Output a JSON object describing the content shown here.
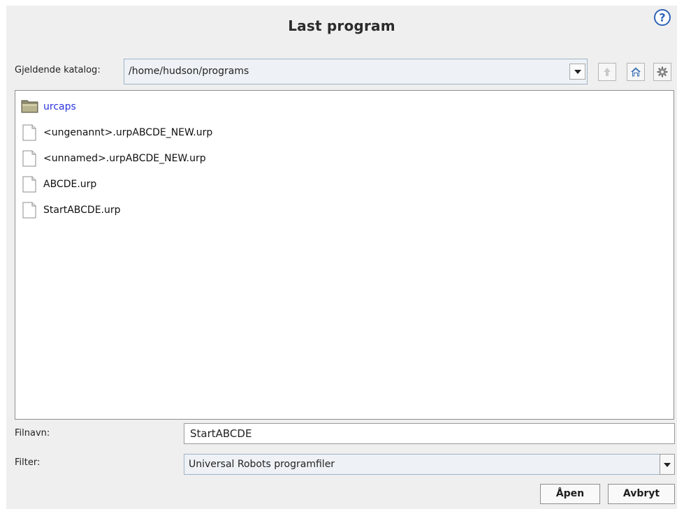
{
  "dialog": {
    "title": "Last program",
    "help_icon": "help-question-icon"
  },
  "directory": {
    "label": "Gjeldende katalog:",
    "path": "/home/hudson/programs",
    "buttons": {
      "up_icon": "arrow-up-icon",
      "home_icon": "home-icon",
      "settings_icon": "gear-icon"
    }
  },
  "files": [
    {
      "name": "urcaps",
      "type": "folder",
      "icon": "folder-icon"
    },
    {
      "name": "<ungenannt>.urpABCDE_NEW.urp",
      "type": "file",
      "icon": "file-icon"
    },
    {
      "name": "<unnamed>.urpABCDE_NEW.urp",
      "type": "file",
      "icon": "file-icon"
    },
    {
      "name": "ABCDE.urp",
      "type": "file",
      "icon": "file-icon"
    },
    {
      "name": "StartABCDE.urp",
      "type": "file",
      "icon": "file-icon"
    }
  ],
  "form": {
    "filename_label": "Filnavn:",
    "filename_value": "StartABCDE",
    "filter_label": "Filter:",
    "filter_value": "Universal Robots programfiler"
  },
  "actions": {
    "open_label": "Åpen",
    "cancel_label": "Avbryt"
  },
  "colors": {
    "dialog_bg": "#efefef",
    "folder_link": "#2b33e0",
    "home_icon_blue": "#3a6fb0",
    "help_icon_blue": "#2e63b8"
  }
}
